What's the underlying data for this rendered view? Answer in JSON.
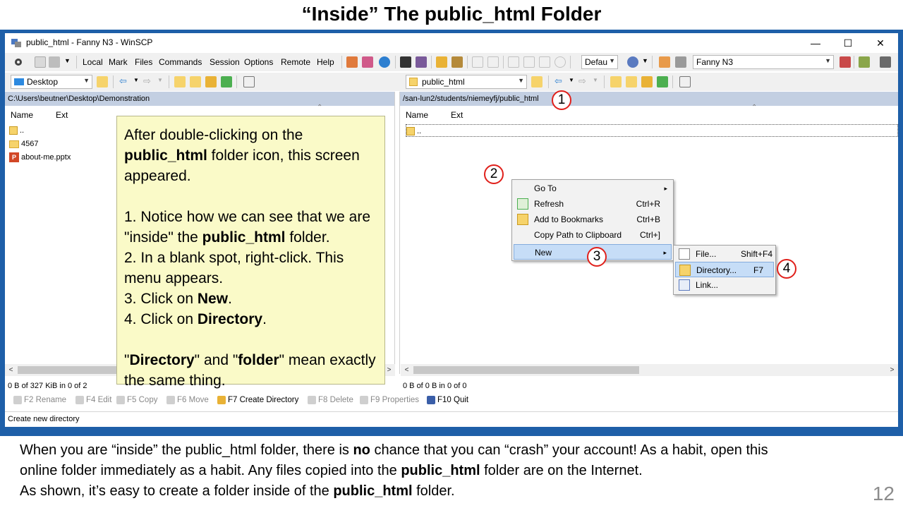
{
  "slide": {
    "title": "“Inside” The public_html Folder",
    "page_number": "12",
    "caption": {
      "line1_a": "When you are “inside” the public_html folder, there is ",
      "line1_b": "no",
      "line1_c": " chance that you can “crash” your account! As a habit, open this",
      "line2_a": "online folder immediately as a habit. Any files copied into the ",
      "line2_b": "public_html",
      "line2_c": " folder are on the Internet.",
      "line3_a": "As shown, it’s easy to create a folder inside of the ",
      "line3_b": "public_html",
      "line3_c": " folder."
    }
  },
  "window": {
    "title": "public_html - Fanny N3 - WinSCP",
    "controls": {
      "minimize": "—",
      "maximize": "☐",
      "close": "✕"
    }
  },
  "menubar": {
    "items": [
      "Local",
      "Mark",
      "Files",
      "Commands",
      "Session",
      "Options",
      "Remote",
      "Help"
    ],
    "transfer_combo": "Defau",
    "session_combo": "Fanny N3"
  },
  "left_panel": {
    "location_combo": "Desktop",
    "path": "C:\\Users\\beutner\\Desktop\\Demonstration",
    "columns": [
      "Name",
      "Ext"
    ],
    "files": [
      {
        "name": "..",
        "type": "updir"
      },
      {
        "name": "4567",
        "type": "folder"
      },
      {
        "name": "about-me.pptx",
        "type": "pptx"
      }
    ],
    "status": "0 B of 327 KiB in 0 of 2"
  },
  "right_panel": {
    "location_combo": "public_html",
    "path": "/san-lun2/students/niemeyfj/public_html",
    "columns": [
      "Name",
      "Ext"
    ],
    "files": [
      {
        "name": "..",
        "type": "updir"
      }
    ],
    "status": "0 B of 0 B in 0 of 0"
  },
  "context_menu": {
    "items": [
      {
        "label": "Go To",
        "shortcut": "",
        "submenu": "▸"
      },
      {
        "label": "Refresh",
        "shortcut": "Ctrl+R"
      },
      {
        "label": "Add to Bookmarks",
        "shortcut": "Ctrl+B"
      },
      {
        "label": "Copy Path to Clipboard",
        "shortcut": "Ctrl+]"
      },
      {
        "label": "New",
        "shortcut": "",
        "submenu": "▸"
      }
    ],
    "submenu": [
      {
        "label": "File...",
        "shortcut": "Shift+F4"
      },
      {
        "label": "Directory...",
        "shortcut": "F7"
      },
      {
        "label": "Link...",
        "shortcut": ""
      }
    ]
  },
  "function_keys": [
    "F2 Rename",
    "F4 Edit",
    "F5 Copy",
    "F6 Move",
    "F7 Create Directory",
    "F8 Delete",
    "F9 Properties",
    "F10 Quit"
  ],
  "bottom_status": "Create new directory",
  "callout": {
    "p1_a": "After double-clicking on the ",
    "p1_b": "public_html",
    "p1_c": " folder icon, this screen appeared.",
    "s1_a": "1. Notice how we can see that we are \"inside\" the ",
    "s1_b": "public_html",
    "s1_c": " folder.",
    "s2": "2. In a blank spot, right-click. This menu appears.",
    "s3_a": "3. Click on ",
    "s3_b": "New",
    "s3_c": ".",
    "s4_a": "4. Click on ",
    "s4_b": "Directory",
    "s4_c": ".",
    "note_a": "\"",
    "note_b": "Directory",
    "note_c": "\" and \"",
    "note_d": "folder",
    "note_e": "\" mean exactly the same thing."
  },
  "badges": [
    "1",
    "2",
    "3",
    "4"
  ],
  "colors": {
    "frame": "#1e5fa8",
    "path_bar": "#c3cfe2",
    "callout": "#fafac8",
    "badge_ring": "#e0201b",
    "highlight": "#c6ddf7"
  }
}
